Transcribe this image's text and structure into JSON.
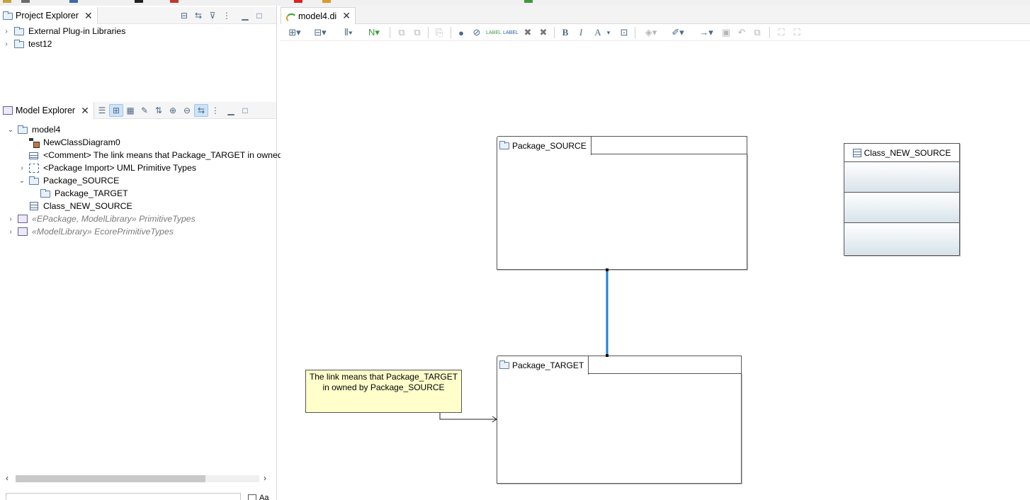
{
  "project_explorer": {
    "title": "Project Explorer",
    "close_glyph": "✕",
    "items": [
      {
        "label": "External Plug-in Libraries",
        "icon": "library-icon"
      },
      {
        "label": "test12",
        "icon": "project-icon"
      }
    ]
  },
  "model_explorer": {
    "title": "Model Explorer",
    "close_glyph": "✕",
    "tree": [
      {
        "label": "model4",
        "icon": "model-icon",
        "expanded": true
      },
      {
        "label": "NewClassDiagram0",
        "icon": "class-diagram-icon"
      },
      {
        "label": "<Comment> The link means that Package_TARGET in owned",
        "icon": "comment-icon"
      },
      {
        "label": "<Package Import> UML Primitive Types",
        "icon": "package-import-icon",
        "expandable": true
      },
      {
        "label": "Package_SOURCE",
        "icon": "package-icon",
        "expanded": true
      },
      {
        "label": "Package_TARGET",
        "icon": "package-icon"
      },
      {
        "label": "Class_NEW_SOURCE",
        "icon": "class-icon"
      },
      {
        "label": "«EPackage, ModelLibrary» PrimitiveTypes",
        "icon": "epackage-icon",
        "dimmed": true
      },
      {
        "label": "«ModelLibrary» EcorePrimitiveTypes",
        "icon": "model-library-icon",
        "dimmed": true
      }
    ],
    "filter_placeholder": "",
    "match_case_label": "Aa"
  },
  "editor": {
    "tab_title": "model4.di",
    "close_glyph": "✕"
  },
  "diagram": {
    "package_source": {
      "name": "Package_SOURCE"
    },
    "package_target": {
      "name": "Package_TARGET"
    },
    "class_new_source": {
      "name": "Class_NEW_SOURCE"
    },
    "comment": {
      "text": "The link means that Package_TARGET in owned by Package_SOURCE"
    },
    "link_color": "#1e7fd8"
  },
  "toolbar_glyphs": {
    "bold": "B",
    "italic": "I",
    "font_color": "A",
    "label": "LABEL"
  }
}
